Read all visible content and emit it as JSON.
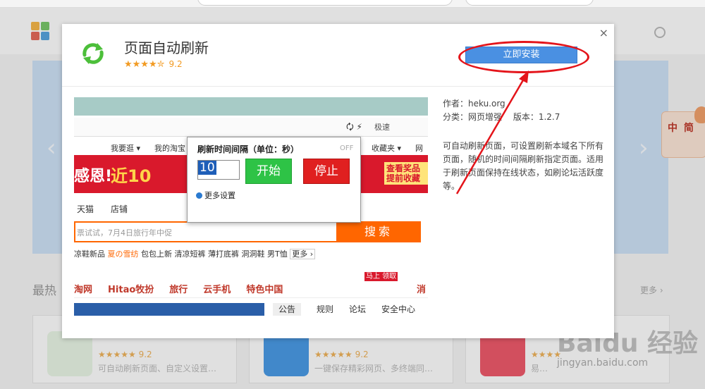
{
  "background": {
    "section_title": "最热",
    "more_label": "更多 ›",
    "badge_text": "中 简",
    "cards": [
      {
        "stars": "★★★★★ 9.2",
        "desc": "可自动刷新页面、自定义设置…"
      },
      {
        "stars": "★★★★★ 9.2",
        "desc": "一键保存精彩网页、多终端同…"
      },
      {
        "stars": "★★★★",
        "desc": "易…"
      }
    ],
    "watermark": "Baidu 经验",
    "watermark_url": "jingyan.baidu.com"
  },
  "modal": {
    "close_label": "×",
    "title": "页面自动刷新",
    "stars": "★★★★✮",
    "score": "9.2",
    "install_label": "立即安装",
    "info": {
      "author": "作者：heku.org",
      "category": "分类：网页增强",
      "version": "版本：1.2.7",
      "description": "可自动刷新页面，可设置刷新本域名下所有页面，随机的时间间隔刷新指定页面。适用于刷新页面保持在线状态，如刷论坛活跃度等。"
    },
    "preview": {
      "toolbar_fast": "极速",
      "nav": [
        "我要逛 ▾",
        "我的淘宝",
        "收藏夹 ▾",
        "网站"
      ],
      "banner_left": "感恩!",
      "banner_mid": "近10",
      "banner_right": "查看奖品 提前收藏",
      "tabs": "天猫　　店铺",
      "search_placeholder": "票试试，7月4日旅行年中促",
      "search_button": "搜索",
      "hot_links": [
        "凉鞋新品",
        "夏の雪纺",
        "包包上新",
        "清凉短裤",
        "薄打底裤",
        "洞洞鞋",
        "男T恤"
      ],
      "hot_more": "更多 ›",
      "categories": [
        "淘网",
        "Hitao牧扮",
        "旅行",
        "云手机",
        "特色中国"
      ],
      "promo_mark": "马上 领取",
      "promo_tail": "消",
      "notice_tabs": [
        "公告",
        "规则",
        "论坛",
        "安全中心"
      ],
      "popup": {
        "title": "刷新时间间隔（单位：秒）",
        "off": "OFF",
        "interval_value": "10",
        "start_label": "开始",
        "stop_label": "停止",
        "more_settings": "更多设置"
      }
    }
  },
  "colors": {
    "install_bg": "#4a90e2",
    "annotation_red": "#e4141a",
    "start_green": "#2ec346",
    "stop_red": "#e02020"
  }
}
